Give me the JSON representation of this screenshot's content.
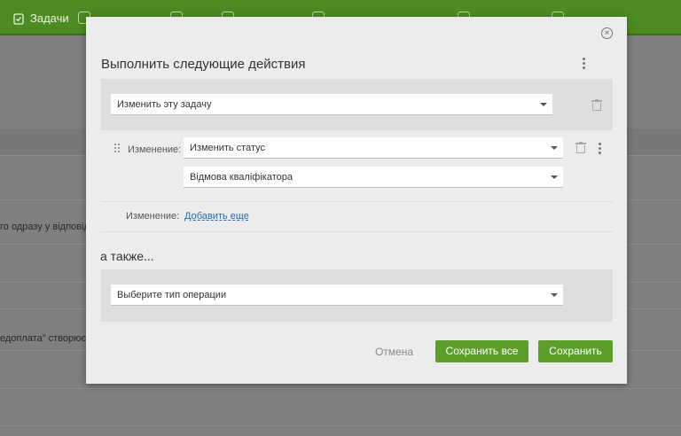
{
  "app": {
    "nav_tasks": "Задачи"
  },
  "background": {
    "row_text_1": "го одразу у відповід",
    "row_text_2": "едоплата\" створюєть"
  },
  "modal": {
    "title": "Выполнить следующие действия",
    "action_select": {
      "value": "Изменить эту задачу"
    },
    "change_row": {
      "label": "Изменение:",
      "field_select": {
        "value": "Изменить статус"
      },
      "value_select": {
        "value": "Відмова кваліфікатора"
      }
    },
    "add_row": {
      "label": "Изменение:",
      "link": "Добавить еще"
    },
    "also_title": "а также...",
    "operation_select": {
      "placeholder": "Выберите тип операции"
    },
    "buttons": {
      "cancel": "Отмена",
      "save_all": "Сохранить все",
      "save": "Сохранить"
    }
  },
  "colors": {
    "topbar": "#4d8a22",
    "primary_button": "#5c9e2a",
    "link": "#2a6aa8"
  }
}
